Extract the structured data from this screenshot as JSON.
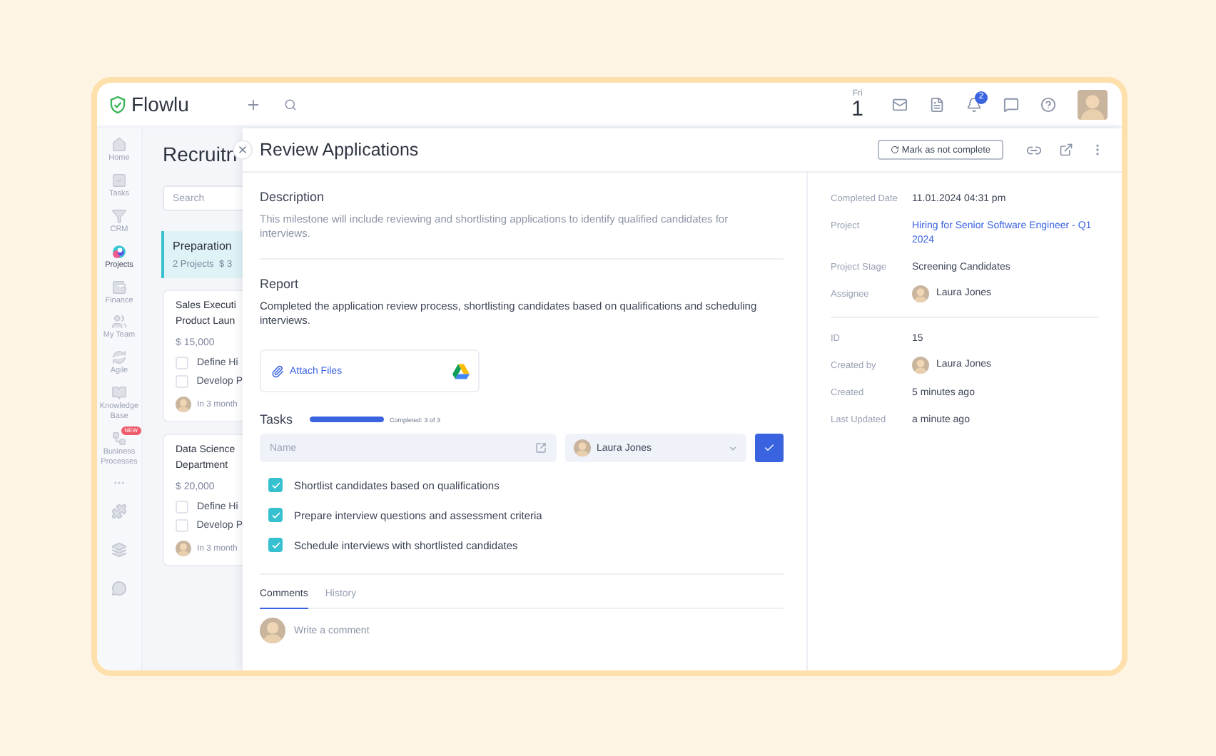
{
  "topbar": {
    "logo": "Flowlu",
    "day": "Fri",
    "date": "1",
    "notification_count": "2"
  },
  "nav": [
    {
      "label": "Home",
      "selected": false
    },
    {
      "label": "Tasks",
      "selected": false
    },
    {
      "label": "CRM",
      "selected": false
    },
    {
      "label": "Projects",
      "selected": true
    },
    {
      "label": "Finance",
      "selected": false
    },
    {
      "label": "My Team",
      "selected": false
    },
    {
      "label": "Agile",
      "selected": false
    },
    {
      "label": "Knowledge Base",
      "selected": false
    },
    {
      "label": "Business Processes",
      "selected": false,
      "badge": "NEW"
    }
  ],
  "board": {
    "title": "Recruitn",
    "search_placeholder": "Search",
    "stage": {
      "name": "Preparation",
      "projects": "2 Projects",
      "amount": "$ 3"
    },
    "cards": [
      {
        "title": [
          "Sales Executi",
          "Product Laun"
        ],
        "amount": "$ 15,000",
        "tasks": [
          {
            "text": "Define Hi",
            "checked": false
          },
          {
            "text": "Develop P",
            "checked": false
          }
        ],
        "due": "In 3 month"
      },
      {
        "title": [
          "Data Science",
          "Department"
        ],
        "amount": "$ 20,000",
        "tasks": [
          {
            "text": "Define Hi",
            "checked": false
          },
          {
            "text": "Develop P",
            "checked": false
          }
        ],
        "due": "In 3 month"
      }
    ]
  },
  "panel": {
    "title": "Review Applications",
    "mark_button": "Mark as not complete",
    "description": {
      "heading": "Description",
      "text": "This milestone will include reviewing and shortlisting applications to identify qualified candidates for interviews."
    },
    "report": {
      "heading": "Report",
      "text": "Completed the application review process, shortlisting candidates based on qualifications and scheduling interviews."
    },
    "attach": "Attach Files",
    "tasks": {
      "heading": "Tasks",
      "level": 1,
      "progress_label": "Completed: 3 of 3",
      "name_placeholder": "Name",
      "assignee": "Laura Jones",
      "items": [
        {
          "text": "Shortlist candidates based on qualifications",
          "checked": true
        },
        {
          "text": "Prepare interview questions and assessment criteria",
          "checked": true
        },
        {
          "text": "Schedule interviews with shortlisted candidates",
          "checked": true
        }
      ]
    },
    "tabs": [
      {
        "label": "Comments",
        "selected": true
      },
      {
        "label": "History",
        "selected": false
      }
    ],
    "comment_placeholder": "Write a comment"
  },
  "details": [
    [
      {
        "label": "Completed Date",
        "value": "11.01.2024 04:31 pm",
        "kind": "text"
      },
      {
        "label": "Project",
        "value": "Hiring for Senior Software Engineer - Q1 2024",
        "kind": "link"
      },
      {
        "label": "Project Stage",
        "value": "Screening Candidates",
        "kind": "text"
      },
      {
        "label": "Assignee",
        "value": "Laura Jones",
        "kind": "person"
      }
    ],
    [
      {
        "label": "ID",
        "value": "15",
        "kind": "text"
      },
      {
        "label": "Created by",
        "value": "Laura Jones",
        "kind": "person"
      },
      {
        "label": "Created",
        "value": "5 minutes ago",
        "kind": "text"
      },
      {
        "label": "Last Updated",
        "value": "a minute ago",
        "kind": "text"
      }
    ]
  ]
}
